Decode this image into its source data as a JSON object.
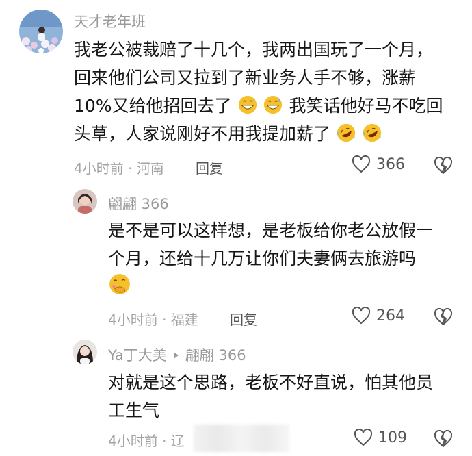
{
  "comments": [
    {
      "username": "天才老年班",
      "text_lines": [
        "我老公被裁赔了十几个，我两出国玩了一个月，",
        "回来他们公司又拉到了新业务人手不够，涨薪",
        "10%又给他招回去了",
        "我笑话他好马不吃回",
        "头草，人家说刚好不用我提加薪了"
      ],
      "emojis": [
        "grinning-sweat-emoji",
        "grinning-sweat-emoji",
        "rofl-emoji",
        "rofl-emoji"
      ],
      "time_location": "4小时前 · 河南",
      "reply_label": "回复",
      "like_count": "366"
    },
    {
      "username": "翩翩 366",
      "text_lines": [
        "是不是可以这样想，是老板给你老公放假一",
        "个月，还给十几万让你们夫妻俩去旅游吗"
      ],
      "emojis": [
        "hand-over-mouth-emoji"
      ],
      "time_location": "4小时前 · 福建",
      "reply_label": "回复",
      "like_count": "264"
    },
    {
      "username": "Ya丁大美",
      "reply_to": "翩翩 366",
      "text_lines": [
        "对就是这个思路，老板不好直说，怕其他员",
        "工生气"
      ],
      "time_location": "4小时前 · 辽",
      "reply_label": "回复",
      "like_count": "109"
    }
  ],
  "colors": {
    "text": "#161616",
    "meta": "#a3a3a3",
    "username": "#9a9a9a",
    "emoji_yellow": "#f5c02b"
  }
}
